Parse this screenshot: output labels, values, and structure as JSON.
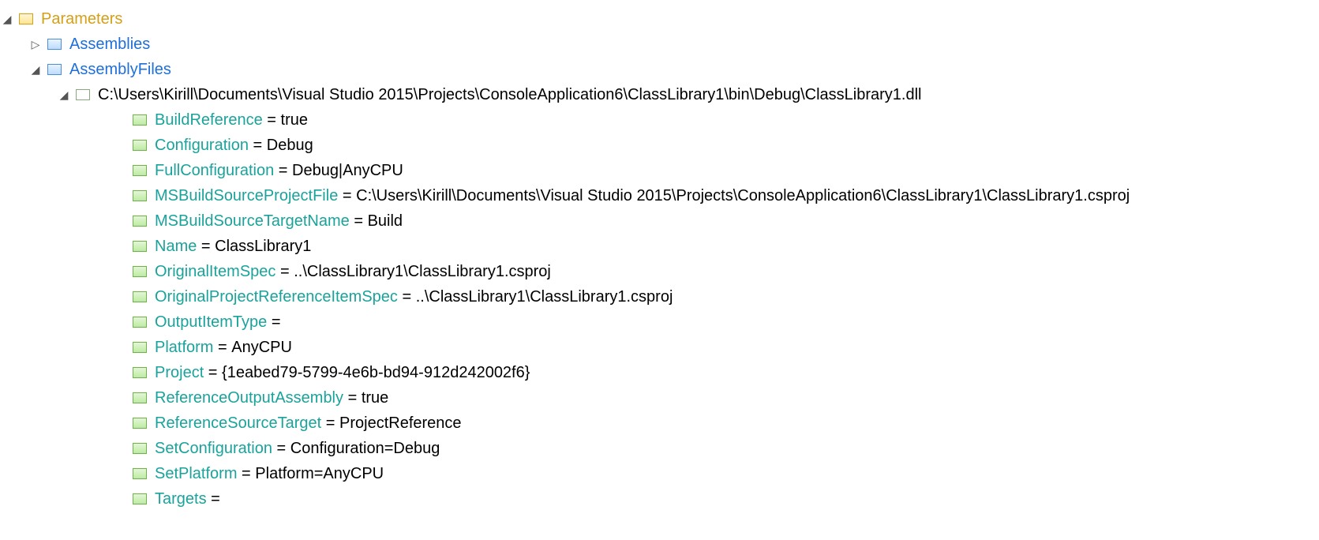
{
  "glyphs": {
    "expanded": "◢",
    "collapsed": "▷"
  },
  "root": {
    "label": "Parameters",
    "children": [
      {
        "id": "assemblies",
        "label": "Assemblies",
        "expanded": false
      },
      {
        "id": "assemblyfiles",
        "label": "AssemblyFiles",
        "expanded": true,
        "children": [
          {
            "id": "dllpath",
            "label": "C:\\Users\\Kirill\\Documents\\Visual Studio 2015\\Projects\\ConsoleApplication6\\ClassLibrary1\\bin\\Debug\\ClassLibrary1.dll",
            "expanded": true,
            "props": [
              {
                "key": "BuildReference",
                "value": "true"
              },
              {
                "key": "Configuration",
                "value": "Debug"
              },
              {
                "key": "FullConfiguration",
                "value": "Debug|AnyCPU"
              },
              {
                "key": "MSBuildSourceProjectFile",
                "value": "C:\\Users\\Kirill\\Documents\\Visual Studio 2015\\Projects\\ConsoleApplication6\\ClassLibrary1\\ClassLibrary1.csproj"
              },
              {
                "key": "MSBuildSourceTargetName",
                "value": "Build"
              },
              {
                "key": "Name",
                "value": "ClassLibrary1"
              },
              {
                "key": "OriginalItemSpec",
                "value": "..\\ClassLibrary1\\ClassLibrary1.csproj"
              },
              {
                "key": "OriginalProjectReferenceItemSpec",
                "value": "..\\ClassLibrary1\\ClassLibrary1.csproj"
              },
              {
                "key": "OutputItemType",
                "value": ""
              },
              {
                "key": "Platform",
                "value": "AnyCPU"
              },
              {
                "key": "Project",
                "value": "{1eabed79-5799-4e6b-bd94-912d242002f6}"
              },
              {
                "key": "ReferenceOutputAssembly",
                "value": "true"
              },
              {
                "key": "ReferenceSourceTarget",
                "value": "ProjectReference"
              },
              {
                "key": "SetConfiguration",
                "value": "Configuration=Debug"
              },
              {
                "key": "SetPlatform",
                "value": "Platform=AnyCPU"
              },
              {
                "key": "Targets",
                "value": ""
              }
            ]
          }
        ]
      }
    ]
  }
}
